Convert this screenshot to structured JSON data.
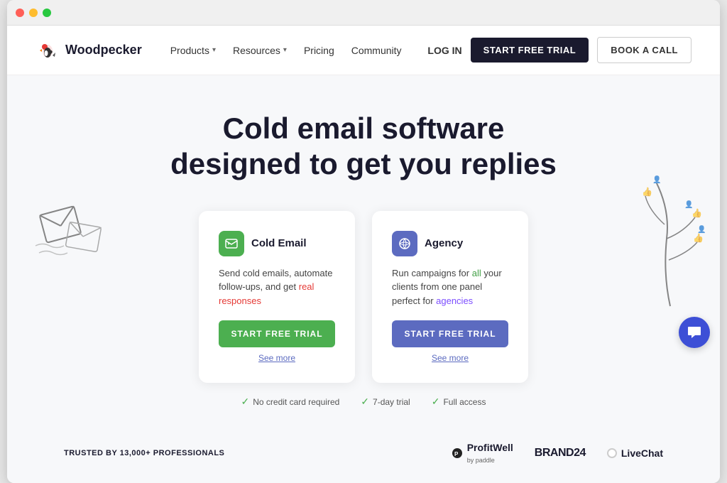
{
  "browser": {
    "buttons": [
      "close",
      "minimize",
      "maximize"
    ]
  },
  "navbar": {
    "logo_text": "Woodpecker",
    "nav_items": [
      {
        "label": "Products",
        "has_dropdown": true
      },
      {
        "label": "Resources",
        "has_dropdown": true
      },
      {
        "label": "Pricing",
        "has_dropdown": false
      },
      {
        "label": "Community",
        "has_dropdown": false
      }
    ],
    "login_label": "LOG IN",
    "start_trial_label": "START FREE TRIAL",
    "book_call_label": "BOOK A CALL"
  },
  "hero": {
    "title_line1": "Cold email software",
    "title_line2": "designed to get you replies"
  },
  "cards": [
    {
      "id": "cold-email",
      "icon_color": "green",
      "title": "Cold Email",
      "description_parts": [
        {
          "text": "Send cold emails, automate follow-ups, and get ",
          "highlight": false
        },
        {
          "text": "real responses",
          "highlight": "red"
        }
      ],
      "description": "Send cold emails, automate follow-ups, and get real responses",
      "cta_label": "START FREE TRIAL",
      "see_more_label": "See more",
      "cta_color": "green"
    },
    {
      "id": "agency",
      "icon_color": "blue",
      "title": "Agency",
      "description": "Run campaigns for all your clients from one panel perfect for agencies",
      "cta_label": "START FREE TRIAL",
      "see_more_label": "See more",
      "cta_color": "blue"
    }
  ],
  "trust_badges": [
    {
      "icon": "check",
      "text": "No credit card required"
    },
    {
      "icon": "check",
      "text": "7-day trial"
    },
    {
      "icon": "check",
      "text": "Full access"
    }
  ],
  "trusted": {
    "label": "TRUSTED BY 13,000+ PROFESSIONALS"
  },
  "logos": [
    {
      "name": "ProfitWell",
      "sub": "by paddle"
    },
    {
      "name": "BRAND24",
      "sub": ""
    },
    {
      "name": "LiveChat",
      "sub": ""
    }
  ]
}
